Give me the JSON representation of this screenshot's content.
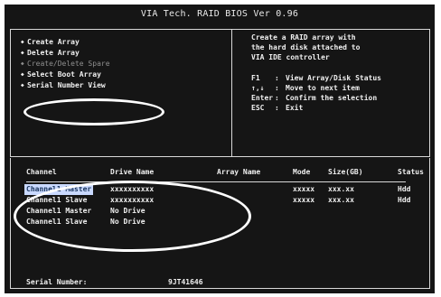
{
  "title": "VIA Tech. RAID BIOS Ver 0.96",
  "menu": {
    "items": [
      {
        "label": "Create Array",
        "disabled": false
      },
      {
        "label": "Delete Array",
        "disabled": false
      },
      {
        "label": "Create/Delete Spare",
        "disabled": true
      },
      {
        "label": "Select Boot Array",
        "disabled": false
      },
      {
        "label": "Serial Number View",
        "disabled": false
      }
    ]
  },
  "help": {
    "description_lines": [
      "Create a RAID array with",
      "the hard disk attached to",
      "VIA IDE controller"
    ],
    "keys": [
      {
        "key": "F1",
        "action": "View Array/Disk Status"
      },
      {
        "key": "↑,↓",
        "action": "Move to next item"
      },
      {
        "key": "Enter",
        "action": "Confirm the selection"
      },
      {
        "key": "ESC",
        "action": "Exit"
      }
    ]
  },
  "table": {
    "headers": [
      "Channel",
      "Drive Name",
      "Array Name",
      "Mode",
      "Size(GB)",
      "Status"
    ],
    "rows": [
      {
        "channel": "Channel1 Master",
        "drive": "xxxxxxxxxx",
        "array": "",
        "mode": "xxxxx",
        "size": "xxx.xx",
        "status": "Hdd",
        "selected": true
      },
      {
        "channel": "Channel1 Slave",
        "drive": "xxxxxxxxxx",
        "array": "",
        "mode": "xxxxx",
        "size": "xxx.xx",
        "status": "Hdd",
        "selected": false
      },
      {
        "channel": "Channel1 Master",
        "drive": "No Drive",
        "array": "",
        "mode": "",
        "size": "",
        "status": "",
        "selected": false
      },
      {
        "channel": "Channel1 Slave",
        "drive": "No Drive",
        "array": "",
        "mode": "",
        "size": "",
        "status": "",
        "selected": false
      }
    ]
  },
  "serial": {
    "label": "Serial Number:",
    "value": "9JT41646"
  },
  "colors": {
    "screen_bg": "#151515",
    "text": "#f0f0f0",
    "border": "#d8d8d8",
    "selection_bg": "#c9d9ff",
    "selection_text": "#18345c",
    "annotation": "#ffffff"
  }
}
